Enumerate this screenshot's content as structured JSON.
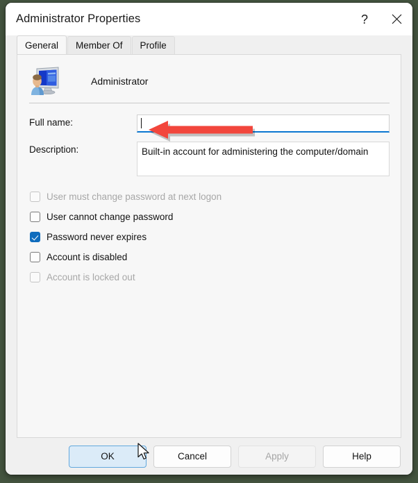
{
  "window": {
    "title": "Administrator Properties",
    "help_icon": "?",
    "close_icon": "close-icon"
  },
  "tabs": [
    {
      "label": "General",
      "active": true
    },
    {
      "label": "Member Of",
      "active": false
    },
    {
      "label": "Profile",
      "active": false
    }
  ],
  "header": {
    "icon": "user-monitor-icon",
    "account_name": "Administrator"
  },
  "fields": [
    {
      "label": "Full name:",
      "value": "",
      "type": "input",
      "focused": true
    },
    {
      "label": "Description:",
      "value": "Built-in account for administering the computer/domain",
      "type": "textarea",
      "focused": false
    }
  ],
  "checkboxes": [
    {
      "label": "User must change password at next logon",
      "checked": false,
      "disabled": true
    },
    {
      "label": "User cannot change password",
      "checked": false,
      "disabled": false
    },
    {
      "label": "Password never expires",
      "checked": true,
      "disabled": false
    },
    {
      "label": "Account is disabled",
      "checked": false,
      "disabled": false
    },
    {
      "label": "Account is locked out",
      "checked": false,
      "disabled": true
    }
  ],
  "annotation": {
    "type": "arrow-left",
    "color": "#f2463c",
    "points_at": "Account is disabled"
  },
  "buttons": [
    {
      "label": "OK",
      "style": "primary",
      "disabled": false
    },
    {
      "label": "Cancel",
      "style": "normal",
      "disabled": false
    },
    {
      "label": "Apply",
      "style": "normal",
      "disabled": true
    },
    {
      "label": "Help",
      "style": "normal",
      "disabled": false
    }
  ],
  "cursor": {
    "icon": "mouse-pointer",
    "over": "OK"
  },
  "colors": {
    "accent": "#0f6cbd",
    "focus_underline": "#0b76d0",
    "annotation_red": "#f2463c",
    "desktop_background": "#44543f"
  }
}
